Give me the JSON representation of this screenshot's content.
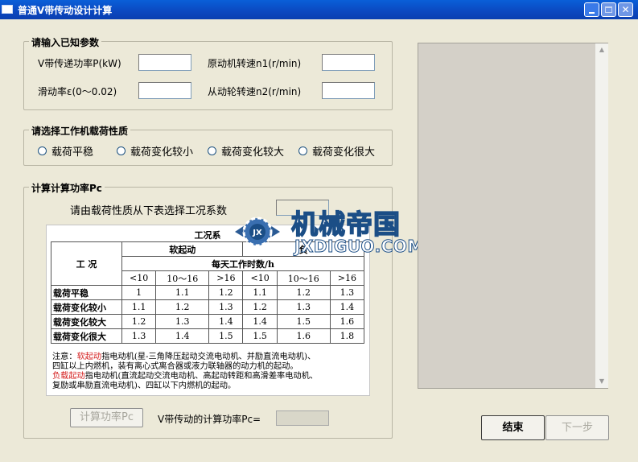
{
  "window": {
    "title": "普通V带传动设计计算"
  },
  "known_params": {
    "legend": "请输入已知参数",
    "power_label": "V带传递功率P(kW)",
    "motor_speed_label": "原动机转速n1(r/min)",
    "slip_label": "滑动率ε(0～0.02)",
    "driven_speed_label": "从动轮转速n2(r/min)",
    "power_value": "",
    "motor_speed_value": "",
    "slip_value": "",
    "driven_speed_value": ""
  },
  "load_nature": {
    "legend": "请选择工作机载荷性质",
    "options": [
      "载荷平稳",
      "载荷变化较小",
      "载荷变化较大",
      "载荷变化很大"
    ]
  },
  "calc": {
    "legend": "计算计算功率Pc",
    "instruction": "请由载荷性质从下表选择工况系数",
    "factor_value": "",
    "calc_button": "计算功率Pc",
    "result_label": "V带传动的计算功率Pc=",
    "result_value": ""
  },
  "table": {
    "title": "工况系",
    "header_condition": "工  况",
    "soft_start": "软起动",
    "load_start": "负",
    "hours_header": "每天工作时数/h",
    "hours": [
      "<10",
      "10～16",
      ">16",
      "<10",
      "10～16",
      ">16"
    ],
    "rows": [
      {
        "name": "载荷平稳",
        "values": [
          "1",
          "1.1",
          "1.2",
          "1.1",
          "1.2",
          "1.3"
        ]
      },
      {
        "name": "载荷变化较小",
        "values": [
          "1.1",
          "1.2",
          "1.3",
          "1.2",
          "1.3",
          "1.4"
        ]
      },
      {
        "name": "载荷变化较大",
        "values": [
          "1.2",
          "1.3",
          "1.4",
          "1.4",
          "1.5",
          "1.6"
        ]
      },
      {
        "name": "载荷变化很大",
        "values": [
          "1.3",
          "1.4",
          "1.5",
          "1.5",
          "1.6",
          "1.8"
        ]
      }
    ],
    "note_prefix": "注意：",
    "note_soft": "软起动",
    "note_line1_rest": "指电动机(星-三角降压起动交流电动机、并励直流电动机)、",
    "note_line2": "四缸以上内燃机，装有离心式离合器或液力联轴器的动力机的起动。",
    "note_load": "负载起动",
    "note_line3_rest": "指电动机(直流起动交流电动机、高起动转距和高滑差率电动机、",
    "note_line4": "复励或串励直流电动机)、四缸以下内燃机的起动。"
  },
  "buttons": {
    "finish": "结束",
    "next": "下一步"
  },
  "watermark": {
    "cn": "机械帝国",
    "en": "JXDIGUO.COM",
    "emblem": "JX"
  }
}
